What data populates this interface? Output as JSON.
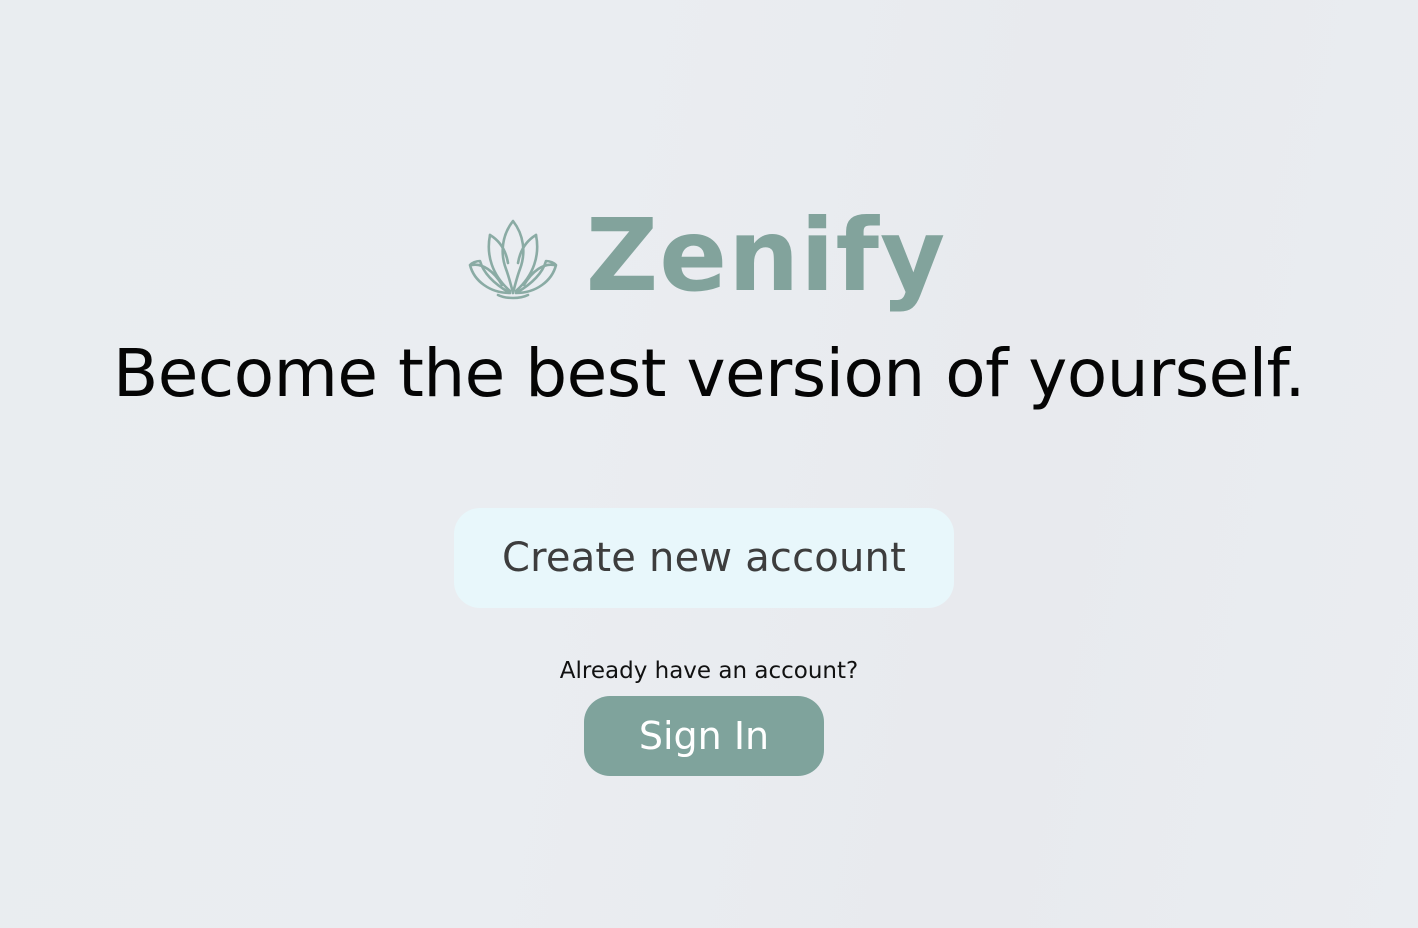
{
  "brand": {
    "name": "Zenify",
    "logo_icon": "lotus-icon",
    "color": "#82a39c"
  },
  "tagline": "Become the best version of yourself.",
  "actions": {
    "create_account_label": "Create new account",
    "already_have_account_text": "Already have an account?",
    "sign_in_label": "Sign In"
  },
  "colors": {
    "accent": "#7fa39c",
    "create_button_bg": "#e8f7fb",
    "background": "#eaedf1"
  }
}
